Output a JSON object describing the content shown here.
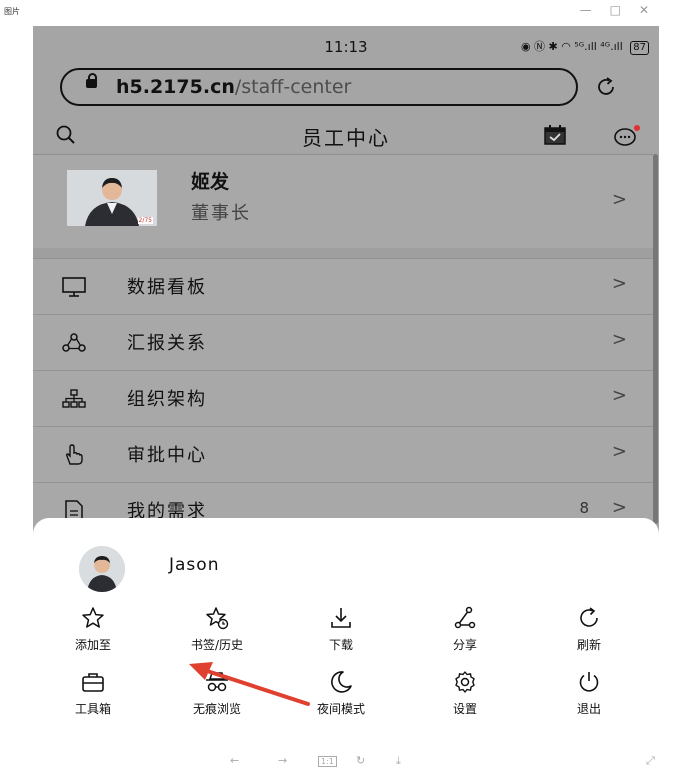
{
  "window": {
    "title": "图片",
    "controls": [
      "—",
      "□",
      "✕"
    ]
  },
  "status": {
    "time": "11:13",
    "signal": "⁵ᴳ.ıll ⁴ᴳ.ıll",
    "battery": "87"
  },
  "browser": {
    "url_host": "h5.2175.cn",
    "url_path": "/staff-center"
  },
  "header": {
    "title": "员工中心"
  },
  "profile": {
    "name": "姬发",
    "role": "董事长",
    "badge": "2/75",
    "chevron": ">"
  },
  "menu": [
    {
      "label": "数据看板",
      "count": "",
      "chevron": ">",
      "icon": "monitor-icon"
    },
    {
      "label": "汇报关系",
      "count": "",
      "chevron": ">",
      "icon": "relation-icon"
    },
    {
      "label": "组织架构",
      "count": "",
      "chevron": ">",
      "icon": "org-chart-icon"
    },
    {
      "label": "审批中心",
      "count": "",
      "chevron": ">",
      "icon": "hand-pointer-icon"
    },
    {
      "label": "我的需求",
      "count": "8",
      "chevron": ">",
      "icon": "document-icon"
    }
  ],
  "sheet": {
    "user": "Jason",
    "items": [
      {
        "label": "添加至",
        "icon": "star-icon"
      },
      {
        "label": "书签/历史",
        "icon": "bookmark-history-icon"
      },
      {
        "label": "下载",
        "icon": "download-icon"
      },
      {
        "label": "分享",
        "icon": "share-icon"
      },
      {
        "label": "刷新",
        "icon": "refresh-icon"
      },
      {
        "label": "工具箱",
        "icon": "toolbox-icon"
      },
      {
        "label": "无痕浏览",
        "icon": "incognito-icon"
      },
      {
        "label": "夜间模式",
        "icon": "moon-icon"
      },
      {
        "label": "设置",
        "icon": "settings-icon"
      },
      {
        "label": "退出",
        "icon": "power-icon"
      }
    ]
  },
  "bottom_nav": [
    "←",
    "→",
    "1:1",
    "↻",
    "⤓",
    "⤢"
  ],
  "colors": {
    "overlay": "#a5a5a5",
    "arrow": "#e0402f",
    "notification": "#e03030"
  }
}
